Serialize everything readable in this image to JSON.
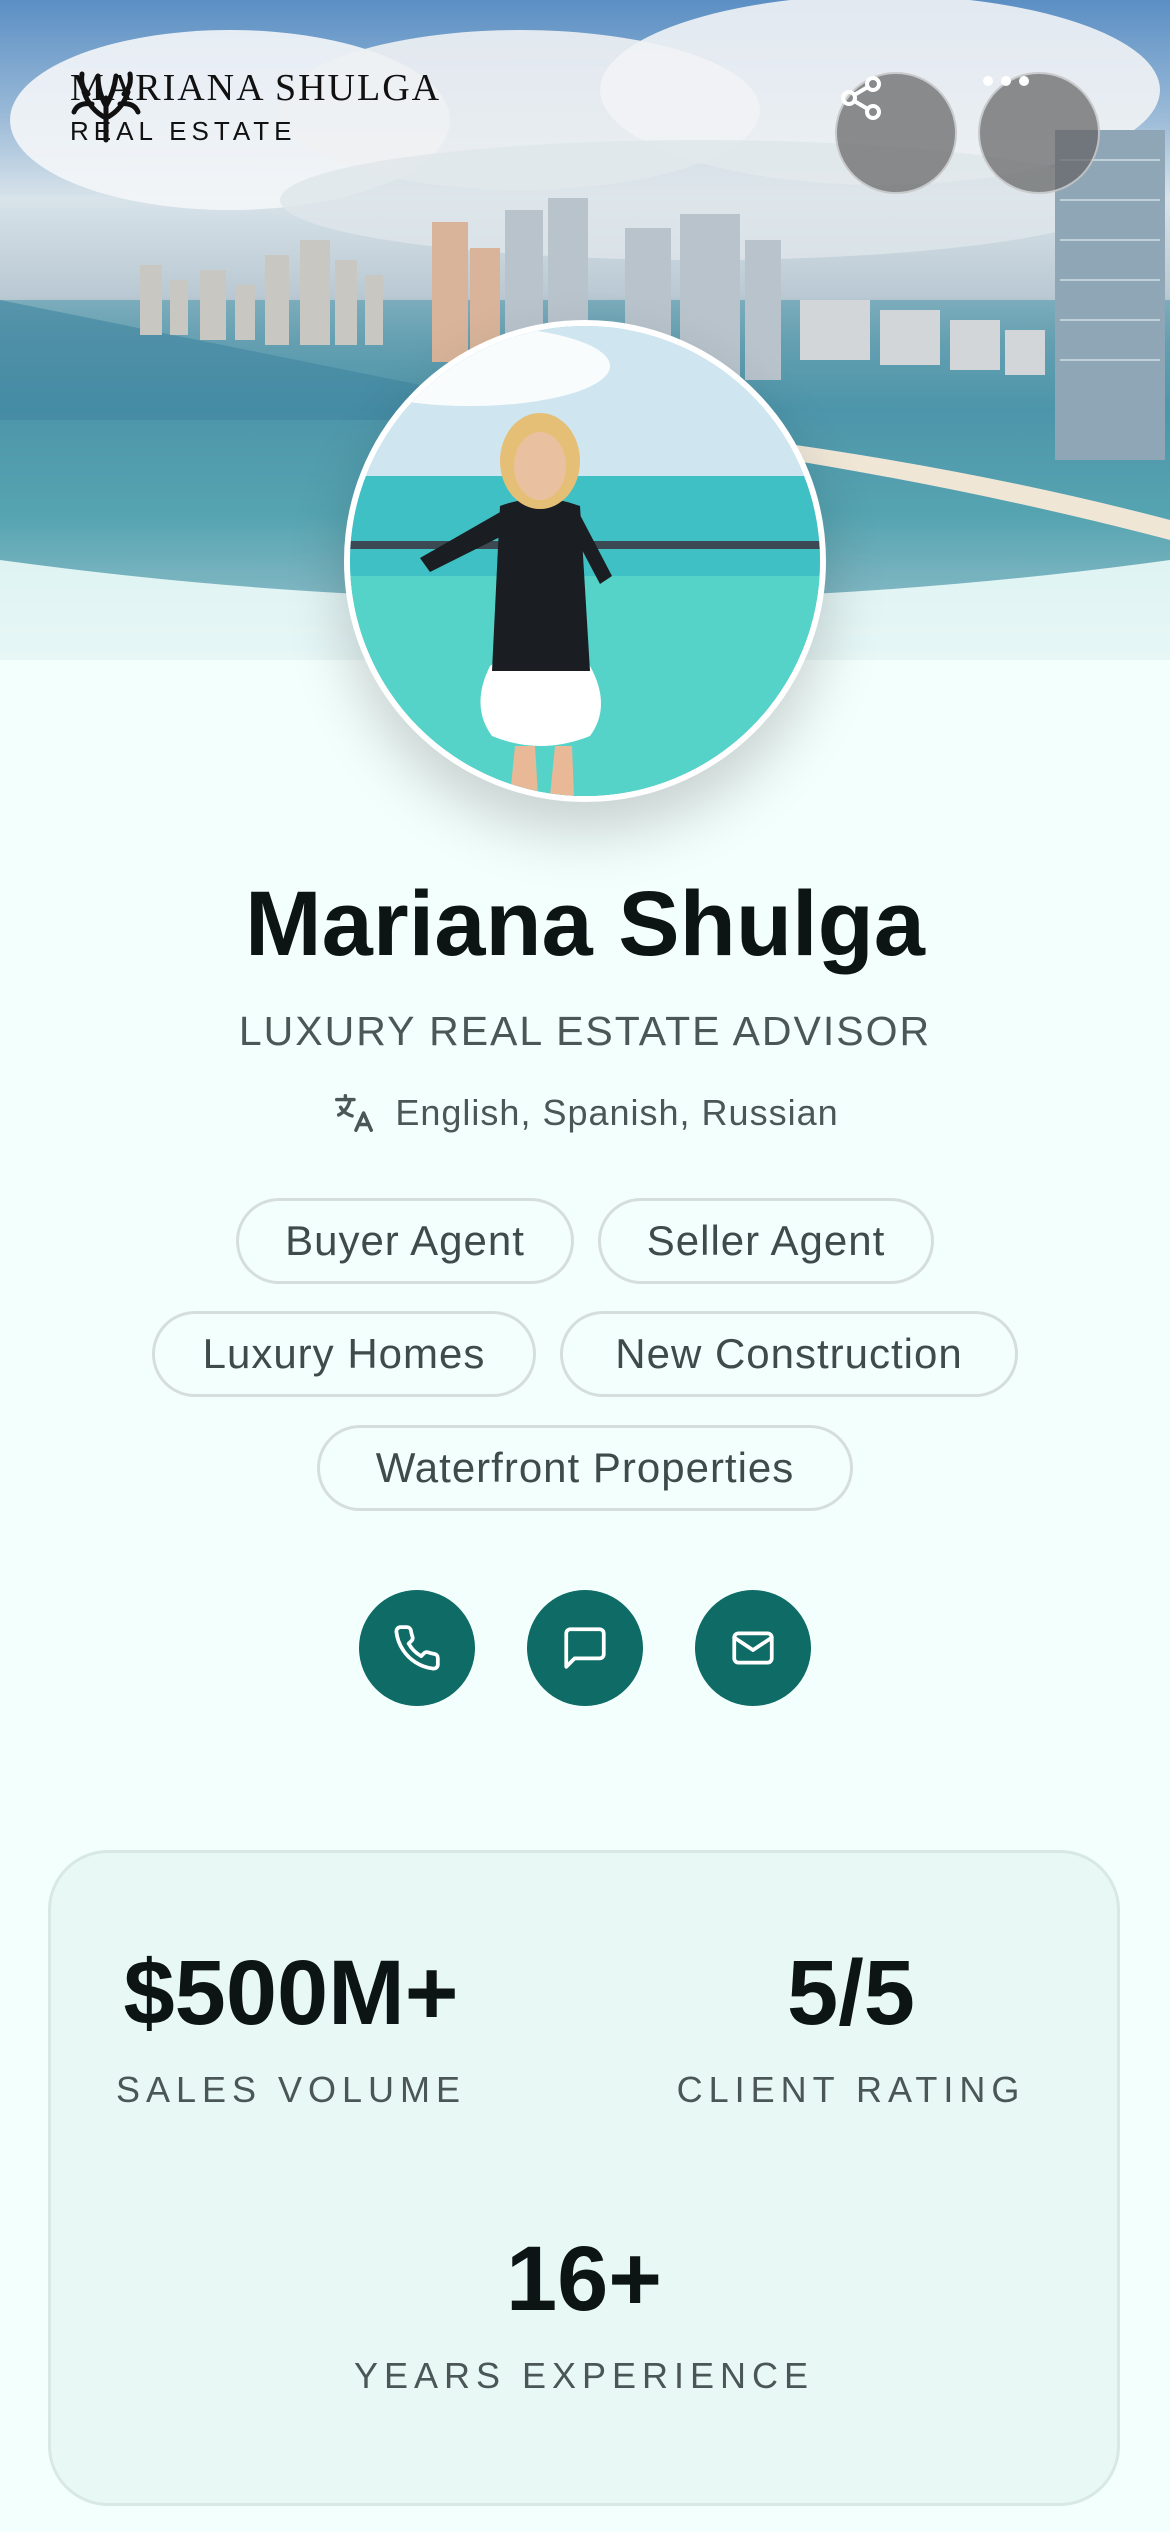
{
  "brand": {
    "name": "MARIANA SHULGA",
    "sub": "REAL ESTATE"
  },
  "header": {
    "share_icon": "share-icon",
    "more_icon": "more-horizontal-icon"
  },
  "profile": {
    "name": "Mariana Shulga",
    "title": "LUXURY REAL ESTATE ADVISOR",
    "languages_icon": "translate-icon",
    "languages": "English, Spanish, Russian"
  },
  "specialties": [
    "Buyer Agent",
    "Seller Agent",
    "Luxury Homes",
    "New Construction",
    "Waterfront Properties"
  ],
  "actions": {
    "phone_icon": "phone-icon",
    "message_icon": "message-icon",
    "email_icon": "mail-icon"
  },
  "stats": [
    {
      "value": "$500M+",
      "label": "SALES VOLUME"
    },
    {
      "value": "5/5",
      "label": "CLIENT RATING"
    },
    {
      "value": "16+",
      "label": "YEARS EXPERIENCE"
    }
  ],
  "colors": {
    "accent": "#0e6b66",
    "background": "#f3fffd",
    "card": "#e7f8f5"
  }
}
